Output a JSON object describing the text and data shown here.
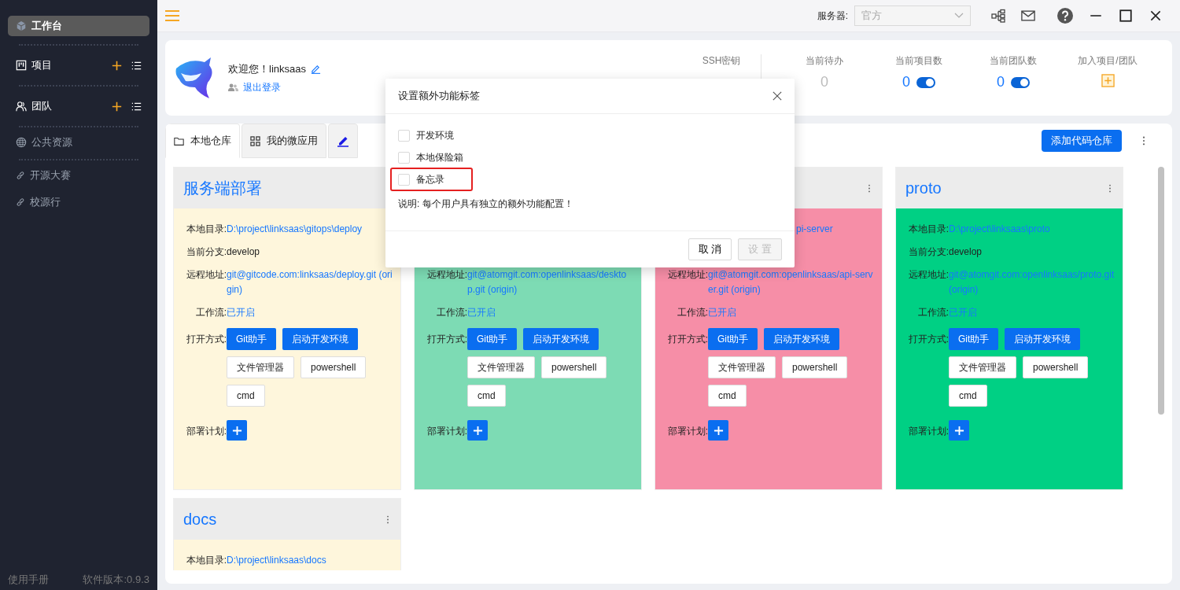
{
  "sidebar": {
    "items": [
      {
        "label": "工作台",
        "kind": "home",
        "selected": true,
        "actions": false
      },
      {
        "label": "项目",
        "kind": "section",
        "selected": false,
        "actions": true
      },
      {
        "label": "团队",
        "kind": "section",
        "selected": false,
        "actions": true
      },
      {
        "label": "公共资源",
        "kind": "link",
        "selected": false,
        "actions": false
      },
      {
        "label": "开源大赛",
        "kind": "link",
        "selected": false,
        "actions": false
      },
      {
        "label": "校源行",
        "kind": "link",
        "selected": false,
        "actions": false
      }
    ],
    "footer": {
      "manual": "使用手册",
      "version": "软件版本:0.9.3"
    }
  },
  "topbar": {
    "server_label": "服务器:",
    "server_value": "官方"
  },
  "header": {
    "greeting": "欢迎您！linksaas",
    "logout": "退出登录",
    "stats": [
      {
        "label": "SSH密钥",
        "kind": "label"
      },
      {
        "label": "当前待办",
        "kind": "count",
        "value": "0"
      },
      {
        "label": "当前项目数",
        "kind": "toggle",
        "value": "0",
        "on": true
      },
      {
        "label": "当前团队数",
        "kind": "toggle",
        "value": "0",
        "on": true
      },
      {
        "label": "加入项目/团队",
        "kind": "add"
      }
    ]
  },
  "tabs": [
    {
      "label": "本地仓库",
      "selected": true
    },
    {
      "label": "我的微应用",
      "selected": false
    },
    {
      "selected": false
    }
  ],
  "add_button": "添加代码仓库",
  "cards": [
    {
      "title": "服务端部署",
      "color": "#fef6dc",
      "rows": [
        {
          "kind": "link",
          "label": "本地目录:",
          "value": "D:\\project\\linksaas\\gitops\\deploy"
        },
        {
          "kind": "text",
          "label": "当前分支:",
          "value": "develop"
        },
        {
          "kind": "link",
          "label": "远程地址:",
          "value": "git@gitcode.com:linksaas/deploy.git (origin)"
        },
        {
          "kind": "link",
          "label": "工作流:",
          "value": "已开启"
        },
        {
          "kind": "buttons",
          "label": "打开方式:",
          "buttons": [
            {
              "label": "Git助手",
              "kind": "primary"
            },
            {
              "label": "启动开发环境",
              "kind": "primary"
            },
            {
              "label": "文件管理器",
              "kind": "default"
            },
            {
              "label": "powershell",
              "kind": "default"
            },
            {
              "label": "cmd",
              "kind": "default"
            }
          ]
        },
        {
          "kind": "plus",
          "label": "部署计划:"
        }
      ]
    },
    {
      "color": "#7ddbb4",
      "rows": [
        {
          "kind": "covered"
        },
        {
          "kind": "covered"
        },
        {
          "kind": "link",
          "label": "远程地址:",
          "value": "git@atomgit.com:openlinksaas/desktop.git (origin)"
        },
        {
          "kind": "link",
          "label": "工作流:",
          "value": "已开启"
        },
        {
          "kind": "buttons",
          "label": "打开方式:",
          "buttons": [
            {
              "label": "Git助手",
              "kind": "primary"
            },
            {
              "label": "启动开发环境",
              "kind": "primary"
            },
            {
              "label": "文件管理器",
              "kind": "default"
            },
            {
              "label": "powershell",
              "kind": "default"
            },
            {
              "label": "cmd",
              "kind": "default"
            }
          ]
        },
        {
          "kind": "plus",
          "label": "部署计划:"
        }
      ]
    },
    {
      "menu": true,
      "color": "#f68ea7",
      "rows": [
        {
          "kind": "tail",
          "value": "pi-server"
        },
        {
          "kind": "covered"
        },
        {
          "kind": "link",
          "label": "远程地址:",
          "value": "git@atomgit.com:openlinksaas/api-server.git (origin)"
        },
        {
          "kind": "link",
          "label": "工作流:",
          "value": "已开启"
        },
        {
          "kind": "buttons",
          "label": "打开方式:",
          "buttons": [
            {
              "label": "Git助手",
              "kind": "primary"
            },
            {
              "label": "启动开发环境",
              "kind": "primary"
            },
            {
              "label": "文件管理器",
              "kind": "default"
            },
            {
              "label": "powershell",
              "kind": "default"
            },
            {
              "label": "cmd",
              "kind": "default"
            }
          ]
        },
        {
          "kind": "plus",
          "label": "部署计划:"
        }
      ]
    },
    {
      "title": "proto",
      "menu": true,
      "color": "#00d084",
      "rows": [
        {
          "kind": "link",
          "label": "本地目录:",
          "value": "D:\\project\\linksaas\\proto"
        },
        {
          "kind": "text",
          "label": "当前分支:",
          "value": "develop"
        },
        {
          "kind": "link",
          "label": "远程地址:",
          "value": "git@atomgit.com:openlinksaas/proto.git (origin)"
        },
        {
          "kind": "link",
          "label": "工作流:",
          "value": "已开启"
        },
        {
          "kind": "buttons",
          "label": "打开方式:",
          "buttons": [
            {
              "label": "Git助手",
              "kind": "primary"
            },
            {
              "label": "启动开发环境",
              "kind": "primary"
            },
            {
              "label": "文件管理器",
              "kind": "default"
            },
            {
              "label": "powershell",
              "kind": "default"
            },
            {
              "label": "cmd",
              "kind": "default"
            }
          ]
        },
        {
          "kind": "plus",
          "label": "部署计划:"
        }
      ]
    },
    {
      "title": "docs",
      "menu": true,
      "color": "#fef6dc",
      "rows": [
        {
          "kind": "link",
          "label": "本地目录:",
          "value": "D:\\project\\linksaas\\docs"
        }
      ]
    }
  ],
  "modal": {
    "title": "设置额外功能标签",
    "options": [
      {
        "label": "开发环境",
        "checked": false
      },
      {
        "label": "本地保险箱",
        "checked": false
      },
      {
        "label": "备忘录",
        "checked": false,
        "highlighted": true
      }
    ],
    "note": "说明: 每个用户具有独立的额外功能配置！",
    "buttons": [
      {
        "label": "取 消",
        "disabled": false
      },
      {
        "label": "设 置",
        "disabled": true
      }
    ]
  }
}
